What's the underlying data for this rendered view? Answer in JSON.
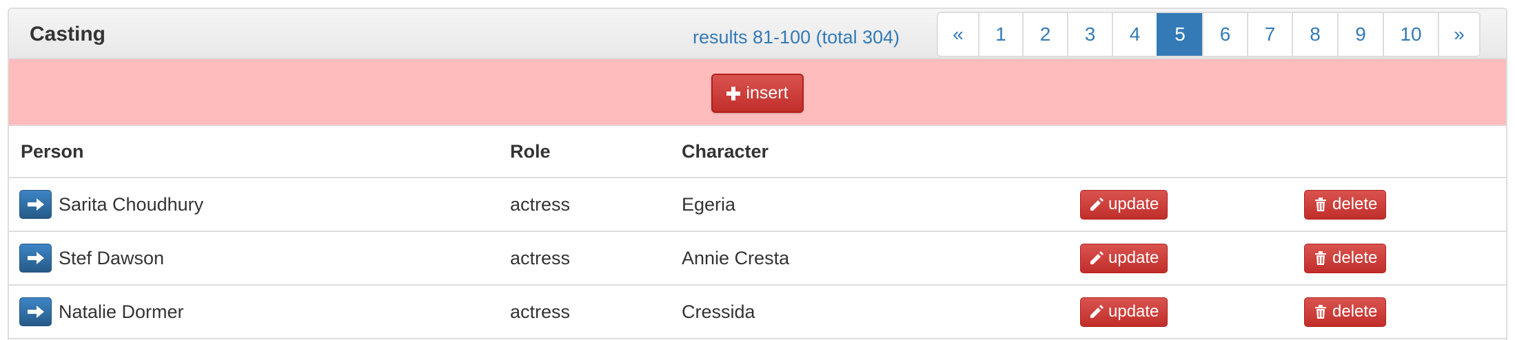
{
  "panel": {
    "title": "Casting",
    "results_text": "results 81-100 (total 304)"
  },
  "pagination": {
    "prev": "«",
    "pages": [
      "1",
      "2",
      "3",
      "4",
      "5",
      "6",
      "7",
      "8",
      "9",
      "10"
    ],
    "current": "5",
    "next": "»"
  },
  "toolbar": {
    "insert_label": "insert"
  },
  "table": {
    "headers": [
      "Person",
      "Role",
      "Character",
      "",
      ""
    ],
    "rows": [
      {
        "person": "Sarita Choudhury",
        "role": "actress",
        "character": "Egeria",
        "update_label": "update",
        "delete_label": "delete"
      },
      {
        "person": "Stef Dawson",
        "role": "actress",
        "character": "Annie Cresta",
        "update_label": "update",
        "delete_label": "delete"
      },
      {
        "person": "Natalie Dormer",
        "role": "actress",
        "character": "Cressida",
        "update_label": "update",
        "delete_label": "delete"
      }
    ]
  },
  "colors": {
    "primary": "#337ab7",
    "danger": "#d9534f",
    "insert_bar": "#ffbcbc"
  },
  "icons": {
    "insert": "plus-icon",
    "go": "arrow-right-icon",
    "update": "pencil-icon",
    "delete": "trash-icon"
  }
}
